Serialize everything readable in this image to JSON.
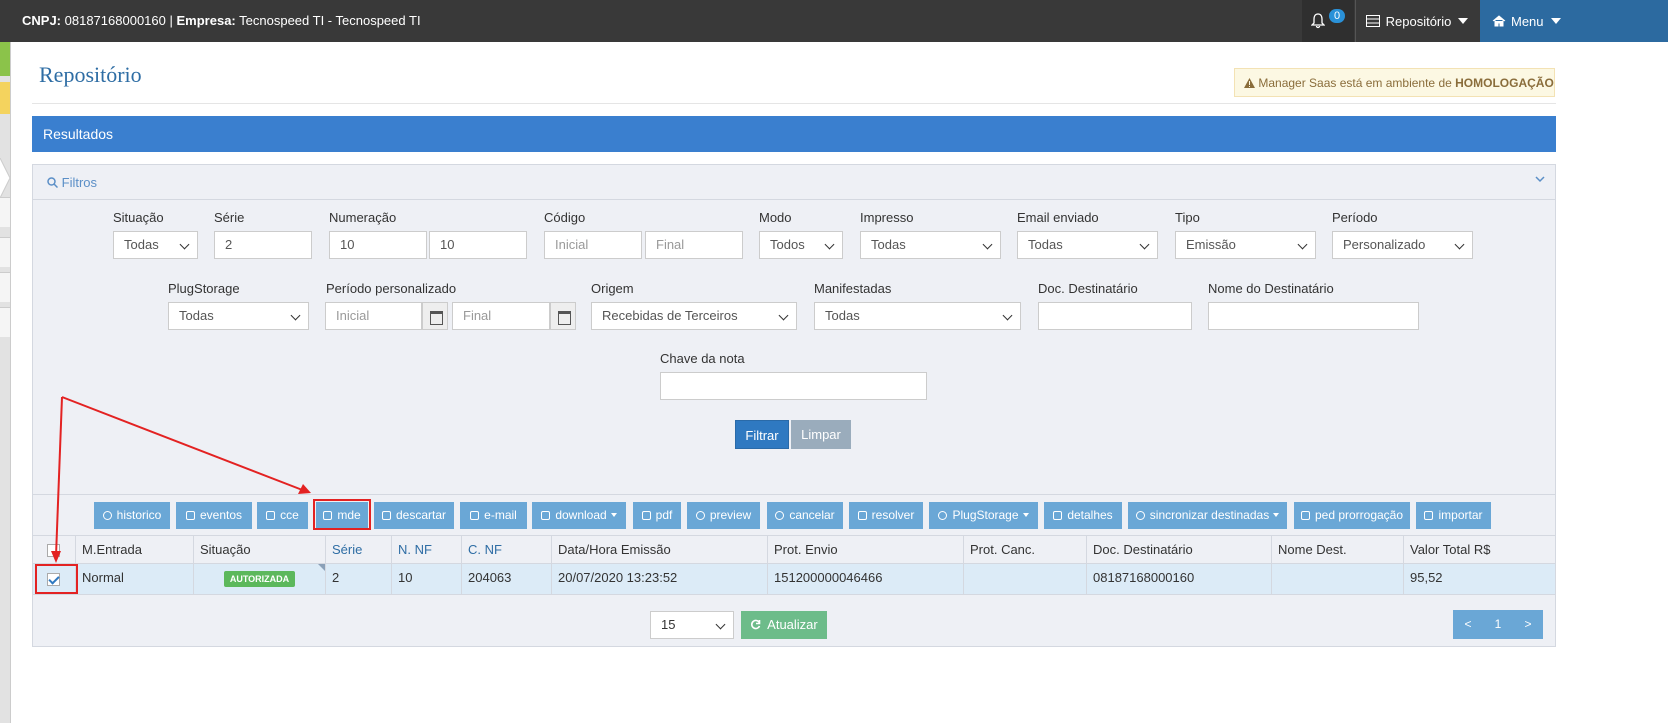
{
  "header": {
    "cnpj_label": "CNPJ:",
    "cnpj_value": "08187168000160",
    "separator": "|",
    "empresa_label": "Empresa:",
    "empresa_value": "Tecnospeed TI - Tecnospeed TI",
    "notifications_count": "0",
    "repositorio_menu": "Repositório",
    "menu_label": "Menu"
  },
  "page": {
    "title": "Repositório",
    "warning_prefix": "Manager Saas está em ambiente de",
    "warning_env": "HOMOLOGAÇÃO",
    "results_title": "Resultados",
    "filters_title": "Filtros"
  },
  "filters": {
    "situacao": {
      "label": "Situação",
      "value": "Todas"
    },
    "serie": {
      "label": "Série",
      "value": "2"
    },
    "numeracao": {
      "label": "Numeração",
      "value_from": "10",
      "value_to": "10"
    },
    "codigo": {
      "label": "Código",
      "placeholder_from": "Inicial",
      "placeholder_to": "Final"
    },
    "modo": {
      "label": "Modo",
      "value": "Todos"
    },
    "impresso": {
      "label": "Impresso",
      "value": "Todas"
    },
    "email_enviado": {
      "label": "Email enviado",
      "value": "Todas"
    },
    "tipo": {
      "label": "Tipo",
      "value": "Emissão"
    },
    "periodo": {
      "label": "Período",
      "value": "Personalizado"
    },
    "plugstorage": {
      "label": "PlugStorage",
      "value": "Todas"
    },
    "periodo_personalizado": {
      "label": "Período personalizado",
      "placeholder_from": "Inicial",
      "placeholder_to": "Final"
    },
    "origem": {
      "label": "Origem",
      "value": "Recebidas de Terceiros"
    },
    "manifestadas": {
      "label": "Manifestadas",
      "value": "Todas"
    },
    "doc_destinatario": {
      "label": "Doc. Destinatário",
      "value": ""
    },
    "nome_destinatario": {
      "label": "Nome do Destinatário",
      "value": ""
    },
    "chave_nota": {
      "label": "Chave da nota",
      "value": ""
    },
    "filtrar_button": "Filtrar",
    "limpar_button": "Limpar"
  },
  "actions": [
    {
      "label": "historico",
      "icon": "clock-icon"
    },
    {
      "label": "eventos",
      "icon": "list-icon"
    },
    {
      "label": "cce",
      "icon": "pencil-icon"
    },
    {
      "label": "mde",
      "icon": "file-icon"
    },
    {
      "label": "descartar",
      "icon": "trash-icon"
    },
    {
      "label": "e-mail",
      "icon": "envelope-icon"
    },
    {
      "label": "download",
      "icon": "download-icon",
      "dropdown": true
    },
    {
      "label": "pdf",
      "icon": "file-icon"
    },
    {
      "label": "preview",
      "icon": "eye-icon"
    },
    {
      "label": "cancelar",
      "icon": "ban-icon"
    },
    {
      "label": "resolver",
      "icon": "check-square-icon"
    },
    {
      "label": "PlugStorage",
      "icon": "cloud-icon",
      "dropdown": true
    },
    {
      "label": "detalhes",
      "icon": "list-icon"
    },
    {
      "label": "sincronizar destinadas",
      "icon": "cloud-download-icon",
      "dropdown": true
    },
    {
      "label": "ped prorrogação",
      "icon": "pencil-icon"
    },
    {
      "label": "importar",
      "icon": "download-icon"
    }
  ],
  "table": {
    "columns": [
      "M.Entrada",
      "Situação",
      "Série",
      "N. NF",
      "C. NF",
      "Data/Hora Emissão",
      "Prot. Envio",
      "Prot. Canc.",
      "Doc. Destinatário",
      "Nome Dest.",
      "Valor Total R$"
    ],
    "rows": [
      {
        "selected": true,
        "m_entrada": "Normal",
        "situacao": "AUTORIZADA",
        "serie": "2",
        "n_nf": "10",
        "c_nf": "204063",
        "data_hora": "20/07/2020 13:23:52",
        "prot_envio": "151200000046466",
        "prot_canc": "",
        "doc_dest": "08187168000160",
        "nome_dest": "",
        "valor_total": "95,52"
      }
    ]
  },
  "footer": {
    "page_size": "15",
    "atualizar_button": "Atualizar",
    "prev_page": "<",
    "current_page": "1",
    "next_page": ">"
  },
  "colors": {
    "topbar": "#393939",
    "menu_bg": "#2c6aa0",
    "results_bar": "#3a7fcf",
    "action_button": "#6aa7d6",
    "status_autorizada": "#5cb85c",
    "annotation_red": "#e32222"
  }
}
